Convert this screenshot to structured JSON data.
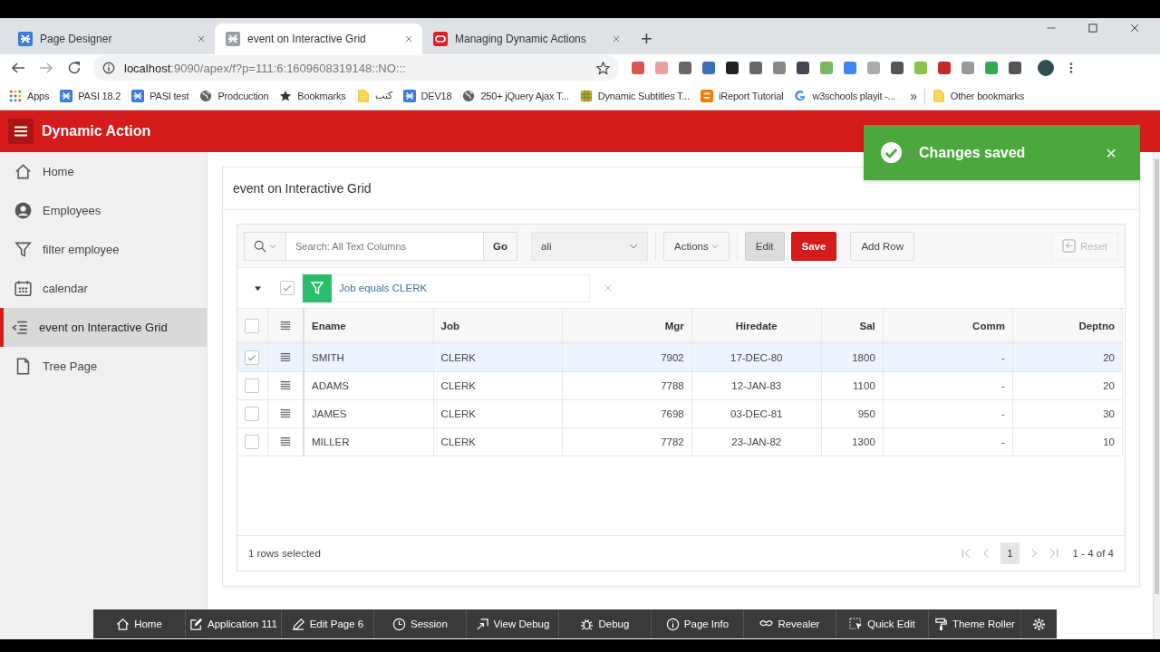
{
  "browser": {
    "tabs": [
      {
        "title": "Page Designer",
        "selected": false
      },
      {
        "title": "event on Interactive Grid",
        "selected": true
      },
      {
        "title": "Managing Dynamic Actions",
        "selected": false
      }
    ],
    "new_tab": "+",
    "url_host": "localhost",
    "url_rest": ":9090/apex/f?p=111:6:1609608319148::NO:::",
    "bookmarks": [
      "Apps",
      "PASI 18.2",
      "PASI test",
      "Prodcuction",
      "Bookmarks",
      "كتب",
      "DEV18",
      "250+ jQuery Ajax T...",
      "Dynamic Subtitles T...",
      "iReport Tutorial",
      "w3schools playit -..."
    ],
    "more": "»",
    "other_bookmarks": "Other bookmarks"
  },
  "app": {
    "title": "Dynamic Action",
    "nav": [
      {
        "label": "Home",
        "selected": false
      },
      {
        "label": "Employees",
        "selected": false
      },
      {
        "label": "filter employee",
        "selected": false
      },
      {
        "label": "calendar",
        "selected": false
      },
      {
        "label": "event on Interactive Grid",
        "selected": true
      },
      {
        "label": "Tree Page",
        "selected": false
      }
    ],
    "region_title": "event on Interactive Grid",
    "toolbar": {
      "search_placeholder": "Search: All Text Columns",
      "go": "Go",
      "report": "ali",
      "actions": "Actions",
      "edit": {
        "label": "Edit",
        "pressed": true
      },
      "save": "Save",
      "add_row": "Add Row",
      "reset": {
        "label": "Reset",
        "disabled": true
      }
    },
    "filter": {
      "label": "Job equals CLERK",
      "checked": true
    },
    "all_selected": false,
    "columns": [
      "Ename",
      "Job",
      "Mgr",
      "Hiredate",
      "Sal",
      "Comm",
      "Deptno"
    ],
    "rows": [
      {
        "selected": true,
        "cells": [
          "SMITH",
          "CLERK",
          "7902",
          "17-DEC-80",
          "1800",
          "-",
          "20"
        ]
      },
      {
        "selected": false,
        "cells": [
          "ADAMS",
          "CLERK",
          "7788",
          "12-JAN-83",
          "1100",
          "-",
          "20"
        ]
      },
      {
        "selected": false,
        "cells": [
          "JAMES",
          "CLERK",
          "7698",
          "03-DEC-81",
          "950",
          "-",
          "30"
        ]
      },
      {
        "selected": false,
        "cells": [
          "MILLER",
          "CLERK",
          "7782",
          "23-JAN-82",
          "1300",
          "-",
          "10"
        ]
      }
    ],
    "footer": {
      "selection": "1 rows selected",
      "page": "1",
      "range": "1 - 4 of 4"
    },
    "toast": {
      "message": "Changes saved",
      "close": "×"
    },
    "dev_toolbar": [
      "Home",
      "Application 111",
      "Edit Page 6",
      "Session",
      "View Debug",
      "Debug",
      "Page Info",
      "Revealer",
      "Quick Edit",
      "Theme Roller"
    ]
  }
}
